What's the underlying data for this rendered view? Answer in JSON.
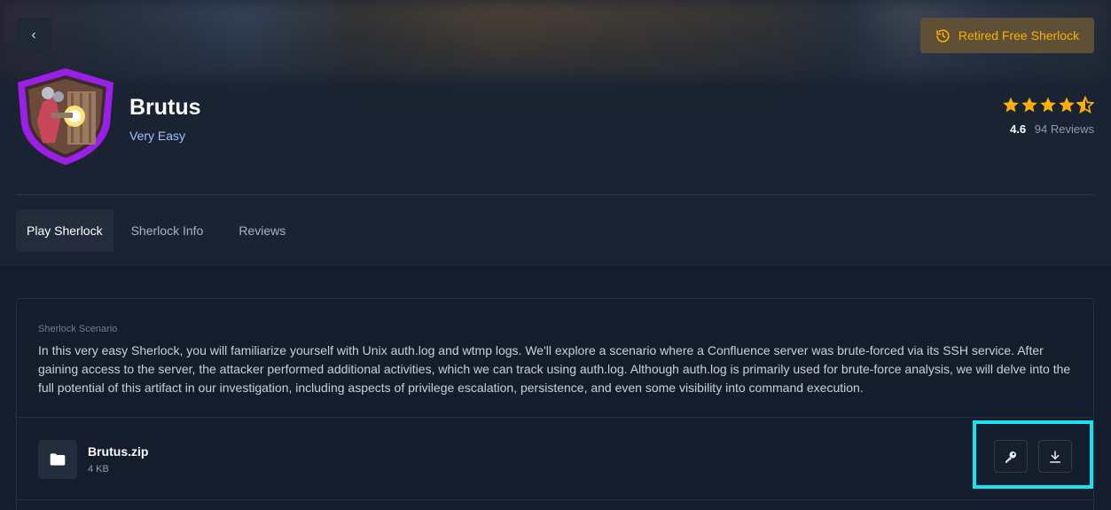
{
  "header": {
    "back_label": "‹",
    "badge_label": "Retired Free Sherlock",
    "badge_icon": "history-icon",
    "accent_color": "#ffaf00"
  },
  "challenge": {
    "title": "Brutus",
    "difficulty": "Very Easy",
    "difficulty_color": "#9fc2ff",
    "logo_icon": "shield-knights-logo"
  },
  "rating": {
    "value": "4.6",
    "reviews": "94 Reviews",
    "stars": 4.5
  },
  "tabs": [
    {
      "label": "Play Sherlock",
      "active": true
    },
    {
      "label": "Sherlock Info",
      "active": false
    },
    {
      "label": "Reviews",
      "active": false
    }
  ],
  "scenario": {
    "label": "Sherlock Scenario",
    "text": "In this very easy Sherlock, you will familiarize yourself with Unix auth.log and wtmp logs. We'll explore a scenario where a Confluence server was brute-forced via its SSH service. After gaining access to the server, the attacker performed additional activities, which we can track using auth.log. Although auth.log is primarily used for brute-force analysis, we will delve into the full potential of this artifact in our investigation, including aspects of privilege escalation, persistence, and even some visibility into command execution."
  },
  "file": {
    "name": "Brutus.zip",
    "size": "4 KB",
    "icon": "folder-icon",
    "actions": [
      "key-icon",
      "download-icon"
    ]
  }
}
